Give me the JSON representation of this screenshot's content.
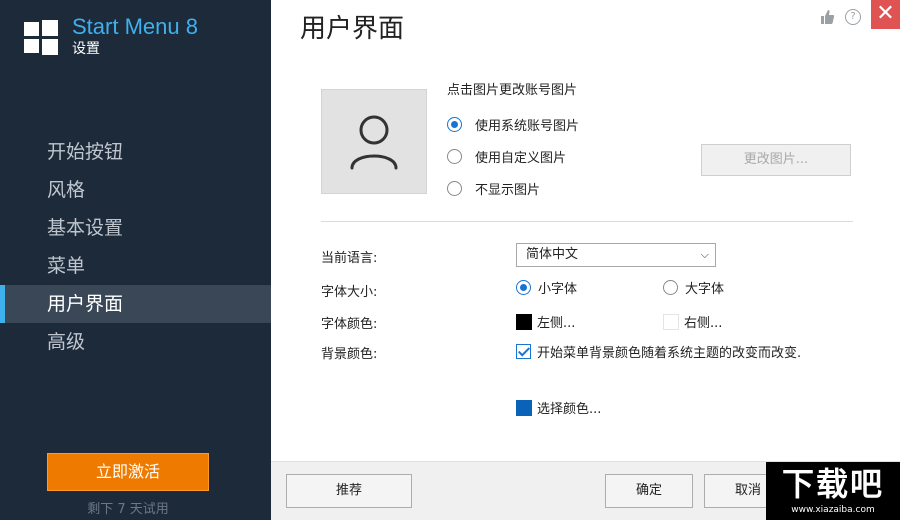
{
  "app": {
    "title": "Start Menu 8",
    "subtitle": "设置"
  },
  "sidebar": {
    "items": [
      {
        "label": "开始按钮"
      },
      {
        "label": "风格"
      },
      {
        "label": "基本设置"
      },
      {
        "label": "菜单"
      },
      {
        "label": "用户界面",
        "active": true
      },
      {
        "label": "高级"
      }
    ],
    "activate_label": "立即激活",
    "trial_text": "剩下 7 天试用"
  },
  "header": {
    "title": "用户界面",
    "icons": [
      "thumbs-up-icon",
      "help-icon",
      "close-icon"
    ]
  },
  "account_picture": {
    "caption": "点击图片更改账号图片",
    "options": [
      {
        "label": "使用系统账号图片",
        "checked": true
      },
      {
        "label": "使用自定义图片",
        "checked": false
      },
      {
        "label": "不显示图片",
        "checked": false
      }
    ],
    "change_button": "更改图片..."
  },
  "form": {
    "language_label": "当前语言:",
    "language_value": "简体中文",
    "font_size_label": "字体大小:",
    "font_size_options": [
      {
        "label": "小字体",
        "checked": true
      },
      {
        "label": "大字体",
        "checked": false
      }
    ],
    "font_color_label": "字体颜色:",
    "font_color_left": "左侧...",
    "font_color_right": "右侧...",
    "font_color_left_swatch": "#000000",
    "font_color_right_swatch": "#ffffff",
    "bg_color_label": "背景颜色:",
    "bg_follow_checkbox": "开始菜单背景颜色随着系统主题的改变而改变.",
    "bg_follow_checked": true,
    "choose_color": "选择颜色...",
    "choose_color_swatch": "#0a63b8"
  },
  "footer": {
    "recommend": "推荐",
    "ok": "确定",
    "cancel": "取消"
  },
  "watermark": {
    "text": "下载吧",
    "url": "www.xiazaiba.com"
  },
  "colors": {
    "sidebar_bg": "#1c2a39",
    "accent": "#3fb0ee",
    "activate": "#ef7a00",
    "close": "#e05353",
    "radio": "#1a73d1"
  }
}
